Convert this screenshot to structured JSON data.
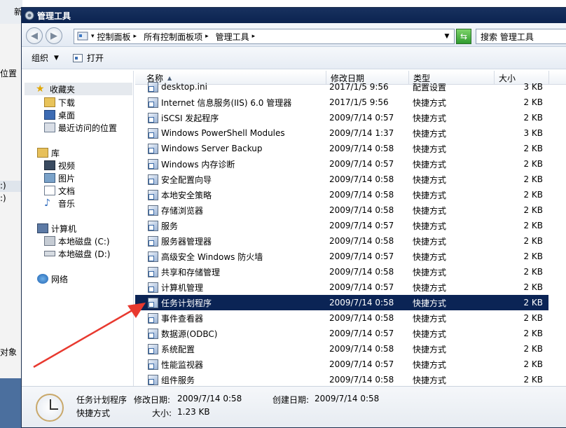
{
  "background_window": {
    "text_1": "新",
    "text_2": "位置",
    "text_3": ":)",
    "text_4": ":)",
    "text_5": "对象"
  },
  "window": {
    "title": "管理工具"
  },
  "address": {
    "breadcrumbs": [
      "控制面板",
      "所有控制面板项",
      "管理工具"
    ],
    "search_placeholder": "搜索 管理工具"
  },
  "toolbar": {
    "organize_label": "组织",
    "open_label": "打开"
  },
  "nav": {
    "favorites": "收藏夹",
    "downloads": "下载",
    "desktop": "桌面",
    "recent": "最近访问的位置",
    "libraries": "库",
    "videos": "视频",
    "pictures": "图片",
    "documents": "文档",
    "music": "音乐",
    "computer": "计算机",
    "disk_c": "本地磁盘 (C:)",
    "disk_d": "本地磁盘 (D:)",
    "network": "网络"
  },
  "columns": {
    "name": "名称",
    "date": "修改日期",
    "type": "类型",
    "size": "大小"
  },
  "files": [
    {
      "name": "desktop.ini",
      "date": "2017/1/5 9:56",
      "type": "配置设置",
      "size": "3 KB"
    },
    {
      "name": "Internet 信息服务(IIS) 6.0 管理器",
      "date": "2017/1/5 9:56",
      "type": "快捷方式",
      "size": "2 KB"
    },
    {
      "name": "iSCSI 发起程序",
      "date": "2009/7/14 0:57",
      "type": "快捷方式",
      "size": "2 KB"
    },
    {
      "name": "Windows PowerShell Modules",
      "date": "2009/7/14 1:37",
      "type": "快捷方式",
      "size": "3 KB"
    },
    {
      "name": "Windows Server Backup",
      "date": "2009/7/14 0:58",
      "type": "快捷方式",
      "size": "2 KB"
    },
    {
      "name": "Windows 内存诊断",
      "date": "2009/7/14 0:57",
      "type": "快捷方式",
      "size": "2 KB"
    },
    {
      "name": "安全配置向导",
      "date": "2009/7/14 0:58",
      "type": "快捷方式",
      "size": "2 KB"
    },
    {
      "name": "本地安全策略",
      "date": "2009/7/14 0:58",
      "type": "快捷方式",
      "size": "2 KB"
    },
    {
      "name": "存储浏览器",
      "date": "2009/7/14 0:58",
      "type": "快捷方式",
      "size": "2 KB"
    },
    {
      "name": "服务",
      "date": "2009/7/14 0:57",
      "type": "快捷方式",
      "size": "2 KB"
    },
    {
      "name": "服务器管理器",
      "date": "2009/7/14 0:58",
      "type": "快捷方式",
      "size": "2 KB"
    },
    {
      "name": "高级安全 Windows 防火墙",
      "date": "2009/7/14 0:57",
      "type": "快捷方式",
      "size": "2 KB"
    },
    {
      "name": "共享和存储管理",
      "date": "2009/7/14 0:58",
      "type": "快捷方式",
      "size": "2 KB"
    },
    {
      "name": "计算机管理",
      "date": "2009/7/14 0:57",
      "type": "快捷方式",
      "size": "2 KB"
    },
    {
      "name": "任务计划程序",
      "date": "2009/7/14 0:58",
      "type": "快捷方式",
      "size": "2 KB"
    },
    {
      "name": "事件查看器",
      "date": "2009/7/14 0:58",
      "type": "快捷方式",
      "size": "2 KB"
    },
    {
      "name": "数据源(ODBC)",
      "date": "2009/7/14 0:57",
      "type": "快捷方式",
      "size": "2 KB"
    },
    {
      "name": "系统配置",
      "date": "2009/7/14 0:58",
      "type": "快捷方式",
      "size": "2 KB"
    },
    {
      "name": "性能监视器",
      "date": "2009/7/14 0:57",
      "type": "快捷方式",
      "size": "2 KB"
    },
    {
      "name": "组件服务",
      "date": "2009/7/14 0:58",
      "type": "快捷方式",
      "size": "2 KB"
    }
  ],
  "selected_file": "任务计划程序",
  "details": {
    "name": "任务计划程序",
    "modified_label": "修改日期:",
    "modified_value": "2009/7/14 0:58",
    "created_label": "创建日期:",
    "created_value": "2009/7/14 0:58",
    "type": "快捷方式",
    "size_label": "大小:",
    "size_value": "1.23 KB"
  },
  "colors": {
    "title_bar": "#0b2350",
    "selection": "#0b2455",
    "annotation_arrow": "#e8392f"
  }
}
